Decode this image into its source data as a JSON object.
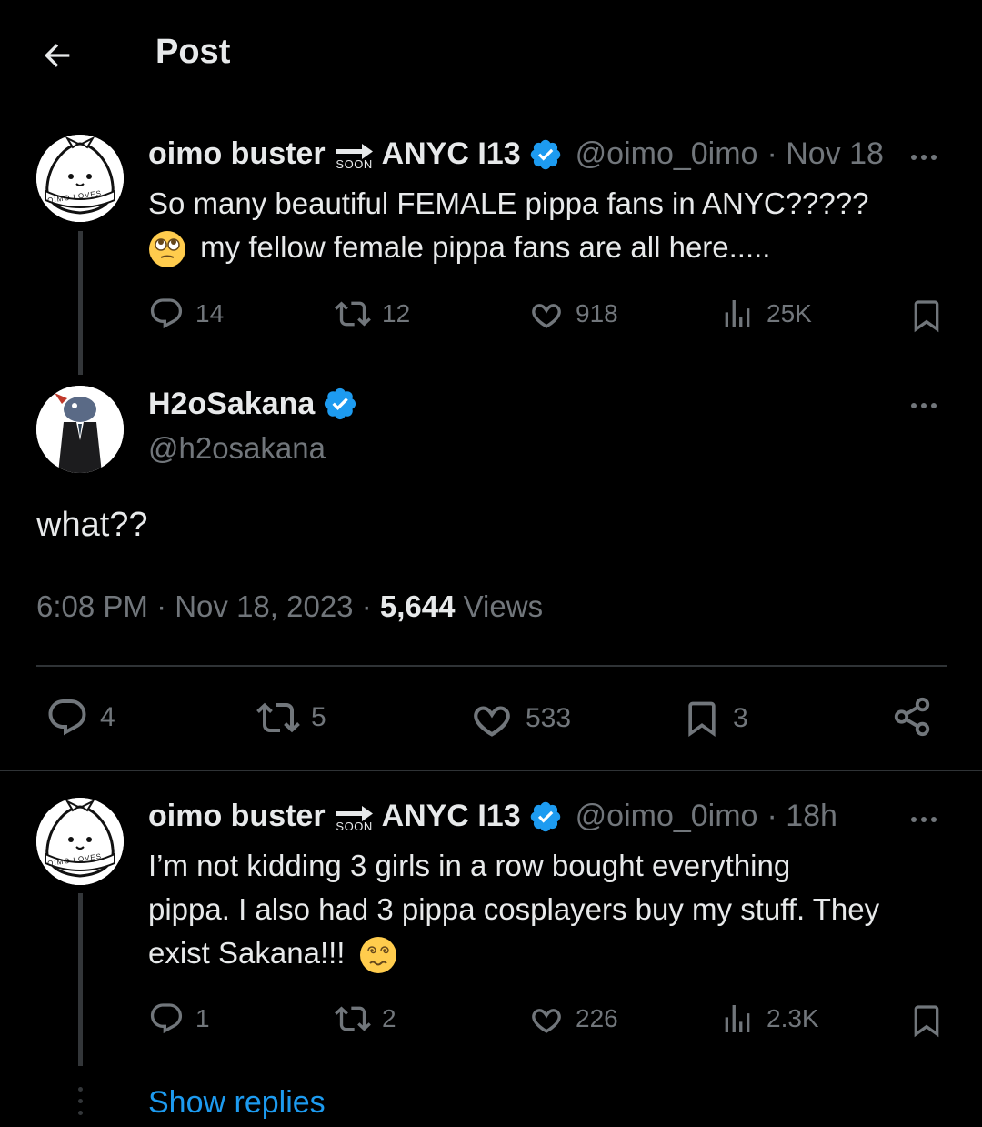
{
  "topbar": {
    "title": "Post"
  },
  "parent_tweet": {
    "name": "oimo buster",
    "soon": "SOON",
    "name_suffix": "ANYC I13",
    "handle": "@oimo_0imo",
    "time": "· Nov 18",
    "text_line1": "So many beautiful FEMALE pippa fans in ANYC?????",
    "text_line2": "my fellow female pippa fans are all here.....",
    "emoji": "rolling-eyes-emoji",
    "avatar_text": "OIMO LOVES",
    "replies": "14",
    "reposts": "12",
    "likes": "918",
    "views": "25K"
  },
  "main_tweet": {
    "name": "H2oSakana",
    "handle": "@h2osakana",
    "text": "what??",
    "time": "6:08 PM · Nov 18, 2023 ·",
    "views_count": "5,644",
    "views_label": "Views",
    "replies": "4",
    "reposts": "5",
    "likes": "533",
    "bookmarks": "3"
  },
  "reply_tweet": {
    "name": "oimo buster",
    "soon": "SOON",
    "name_suffix": "ANYC I13",
    "handle": "@oimo_0imo",
    "time": "· 18h",
    "text_line1": "I’m not kidding 3 girls in a row bought everything",
    "text_line2": "pippa. I also had 3 pippa cosplayers buy my stuff. They",
    "text_line3": "exist Sakana!!!",
    "emoji": "dizzy-face-emoji",
    "avatar_text": "OIMO LOVES",
    "replies": "1",
    "reposts": "2",
    "likes": "226",
    "views": "2.3K"
  },
  "show_replies": "Show replies",
  "colors": {
    "background": "#000000",
    "text": "#e7e9ea",
    "muted": "#71767b",
    "accent": "#1d9bf0",
    "divider": "#2f3336"
  }
}
